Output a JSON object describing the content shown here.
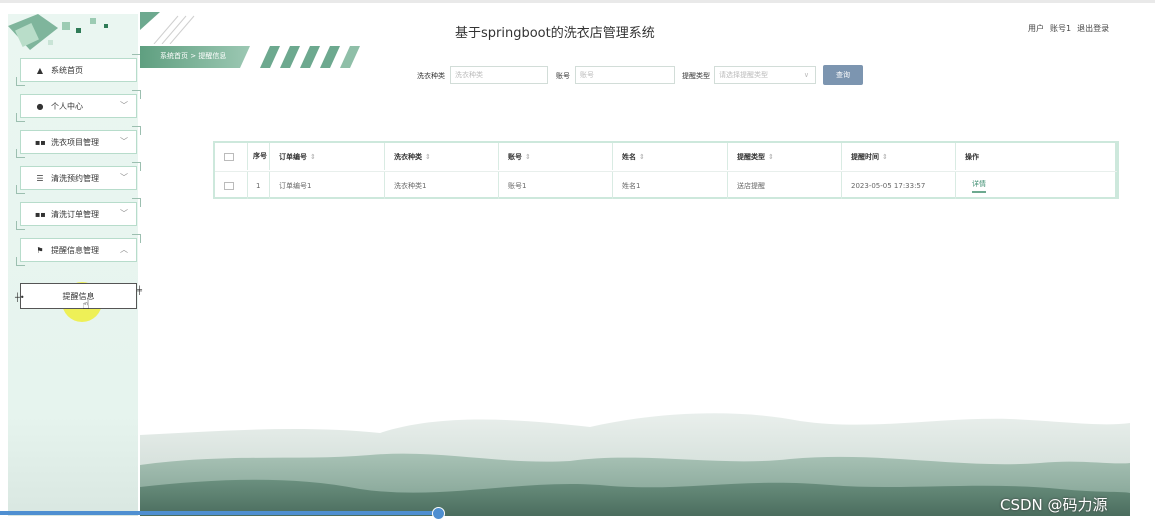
{
  "app": {
    "title": "基于springboot的洗衣店管理系统",
    "user_label": "用户",
    "username": "账号1",
    "logout": "退出登录"
  },
  "breadcrumb": "系统首页 > 提醒信息",
  "sidebar": {
    "items": [
      {
        "label": "系统首页",
        "icon": "home-icon",
        "chevron": ""
      },
      {
        "label": "个人中心",
        "icon": "user-icon",
        "chevron": "﹀"
      },
      {
        "label": "洗衣项目管理",
        "icon": "grid-icon",
        "chevron": "﹀"
      },
      {
        "label": "清洗预约管理",
        "icon": "list-icon",
        "chevron": "﹀"
      },
      {
        "label": "清洗订单管理",
        "icon": "grid-icon",
        "chevron": "﹀"
      },
      {
        "label": "提醒信息管理",
        "icon": "flag-icon",
        "chevron": "︿"
      }
    ],
    "sub_item": {
      "label": "提醒信息"
    }
  },
  "search": {
    "fields": [
      {
        "label": "洗衣种类",
        "placeholder": "洗衣种类"
      },
      {
        "label": "账号",
        "placeholder": "账号"
      },
      {
        "label": "提醒类型",
        "placeholder": "请选择提醒类型"
      }
    ],
    "query_button": "查询"
  },
  "table": {
    "columns": [
      "序号",
      "订单编号",
      "洗衣种类",
      "账号",
      "姓名",
      "提醒类型",
      "提醒时间",
      "操作"
    ],
    "rows": [
      [
        "1",
        "订单编号1",
        "洗衣种类1",
        "账号1",
        "姓名1",
        "送店提醒",
        "2023-05-05 17:33:57",
        "详情"
      ]
    ]
  },
  "watermark": "CSDN @码力源",
  "colors": {
    "accent_green": "#6da98f",
    "sidebar_bg": "#e6f4ee",
    "button_blue": "#7c95b0",
    "mountain_green": "#4f7a66"
  }
}
